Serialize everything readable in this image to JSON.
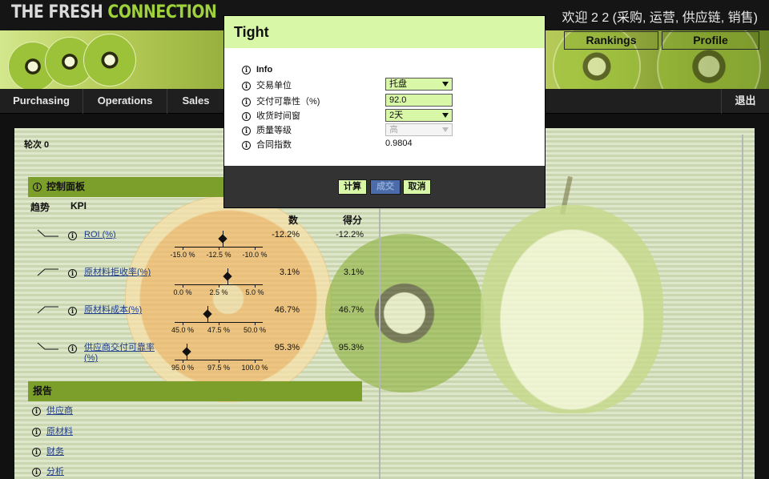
{
  "header": {
    "logo_part1": "THE FRESH ",
    "logo_part2": "CONNECTION",
    "welcome": "欢迎  2 2 (采购, 运营, 供应链, 销售)"
  },
  "nav": {
    "rankings": "Rankings",
    "profile": "Profile"
  },
  "menu": {
    "items": [
      "Purchasing",
      "Operations",
      "Sales"
    ],
    "logout": "退出"
  },
  "content": {
    "round_label": "轮次 0",
    "dashboard_title": "控制面板",
    "columns": {
      "trend": "趋势",
      "kpi": "KPI",
      "raw_partial": "数",
      "score_partial": "得分"
    },
    "kpis": [
      {
        "name": "ROI (%)",
        "trend": "down",
        "ticks": [
          "-15.0 %",
          "-12.5 %",
          "-10.0 %"
        ],
        "marker_value": -12.2,
        "raw": "-12.2%",
        "score": "-12.2%"
      },
      {
        "name": "原材料拒收率(%)",
        "trend": "up",
        "ticks": [
          "0.0 %",
          "2.5 %",
          "5.0 %"
        ],
        "marker_value": 3.1,
        "raw": "3.1%",
        "score": "3.1%"
      },
      {
        "name": "原材料成本(%)",
        "trend": "up",
        "ticks": [
          "45.0 %",
          "47.5 %",
          "50.0 %"
        ],
        "marker_value": 46.7,
        "raw": "46.7%",
        "score": "46.7%"
      },
      {
        "name": "供应商交付可靠率 (%)",
        "trend": "down",
        "ticks": [
          "95.0 %",
          "97.5 %",
          "100.0 %"
        ],
        "marker_value": 95.3,
        "raw": "95.3%",
        "score": "95.3%"
      }
    ],
    "reports_title": "报告",
    "reports": [
      "供应商",
      "原材料",
      "财务",
      "分析"
    ]
  },
  "modal": {
    "title": "Tight",
    "info_label": "Info",
    "rows": [
      {
        "label": "交易单位",
        "value": "托盘",
        "kind": "select"
      },
      {
        "label": "交付可靠性（%)",
        "value": "92.0",
        "kind": "text"
      },
      {
        "label": "收货时间窗",
        "value": "2天",
        "kind": "select"
      },
      {
        "label": "质量等级",
        "value": "高",
        "kind": "select-disabled"
      },
      {
        "label": "合同指数",
        "value": "0.9804",
        "kind": "value"
      }
    ],
    "buttons": {
      "calculate": "计算",
      "deal": "成交",
      "cancel": "取消"
    }
  },
  "colors": {
    "accent_green": "#7c9e2a",
    "modal_green": "#d8f8a8",
    "link_blue": "#1f3c8a"
  }
}
